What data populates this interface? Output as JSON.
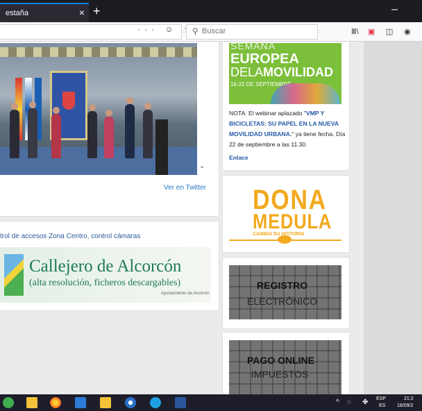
{
  "browser": {
    "tab_title": "estaña",
    "tab_close": "×",
    "new_tab": "+",
    "minimize": "–",
    "url_actions": "··· ☺ ☆",
    "search_placeholder": "Buscar",
    "toolbar_icons": [
      "library-icon",
      "pocket-icon",
      "sidebar-icon",
      "account-icon"
    ]
  },
  "main": {
    "twitter_link": "Ver en Twitter",
    "tags_line": "trol de accesos Zona Centro, control cámaras",
    "callejero": {
      "title": "Callejero de Alcorcón",
      "subtitle": "(alta resolución, ficheros descargables)",
      "logo_text": "Ayuntamiento de Alcorcón"
    }
  },
  "sidebar": {
    "semana": {
      "line1": "SEMANA",
      "line2": "EUROPEA",
      "line3a": "DELA",
      "line3b": "MOVILIDAD",
      "dates": "16-22 DE SEPTIEMBRE"
    },
    "nota": {
      "prefix": "NOTA. El webinar aplazado \"",
      "link": "VMP Y BICICLETAS: SU PAPEL EN LA NUEVA MOVILIDAD URBANA.",
      "suffix": "\" ya tiene fecha. Día 22 de septiembre a las 11.30.",
      "enlace": "Enlace"
    },
    "dona": {
      "line1": "DONA",
      "line2": "MEDULA",
      "tagline": "CAMBIA SU HISTORIA"
    },
    "registro": {
      "line1": "REGISTRO",
      "line2": "ELECTRÓNICO"
    },
    "pago": {
      "line1": "PAGO ONLINE",
      "line2": "IMPUESTOS"
    }
  },
  "taskbar": {
    "tray_arrow": "^",
    "lang_top": "ESP",
    "lang_bottom": "ES",
    "time": "21:2",
    "date": "18/09/2"
  },
  "colors": {
    "accent_green": "#7cbf3a",
    "dona_orange": "#f2a91d",
    "link_blue": "#2458a8",
    "callejero_green": "#1e7a55"
  }
}
